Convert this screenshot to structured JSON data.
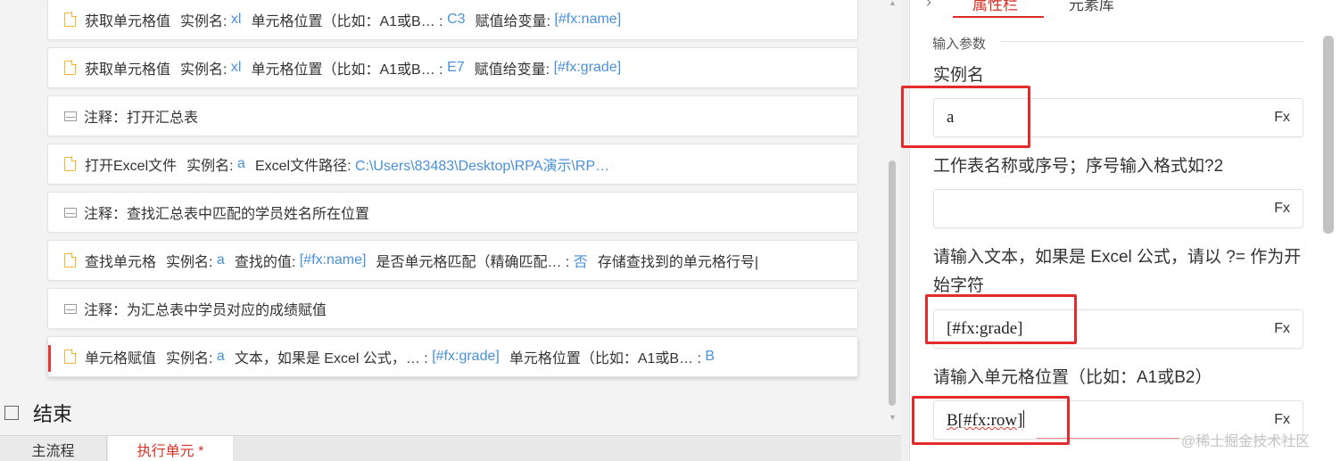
{
  "steps": [
    {
      "kind": "action",
      "title": "获取单元格值",
      "label1": "实例名:",
      "val1": "xl",
      "label2": "单元格位置（比如：A1或B… :",
      "val2": "C3",
      "label3": "赋值给变量:",
      "val3": "[#fx:name]"
    },
    {
      "kind": "action",
      "title": "获取单元格值",
      "label1": "实例名:",
      "val1": "xl",
      "label2": "单元格位置（比如：A1或B… :",
      "val2": "E7",
      "label3": "赋值给变量:",
      "val3": "[#fx:grade]"
    },
    {
      "kind": "comment",
      "title": "注释：打开汇总表"
    },
    {
      "kind": "action",
      "title": "打开Excel文件",
      "label1": "实例名:",
      "val1": "a",
      "label2": "Excel文件路径:",
      "val2": "C:\\Users\\83483\\Desktop\\RPA演示\\RP…"
    },
    {
      "kind": "comment",
      "title": "注释：查找汇总表中匹配的学员姓名所在位置"
    },
    {
      "kind": "action",
      "title": "查找单元格",
      "label1": "实例名:",
      "val1": "a",
      "label2": "查找的值:",
      "val2": "[#fx:name]",
      "label3": "是否单元格匹配（精确匹配… :",
      "val3": "否",
      "label4": "存储查找到的单元格行号|"
    },
    {
      "kind": "comment",
      "title": "注释：为汇总表中学员对应的成绩赋值"
    },
    {
      "kind": "action",
      "active": true,
      "title": "单元格赋值",
      "label1": "实例名:",
      "val1": "a",
      "label2": "文本，如果是 Excel 公式，… :",
      "val2": "[#fx:grade]",
      "label3": "单元格位置（比如：A1或B… :",
      "val3": "B"
    }
  ],
  "end_label": "结束",
  "bottom_tabs": {
    "main": "主流程",
    "exec": "执行单元 *"
  },
  "right_panel": {
    "tab_props": "属性栏",
    "tab_lib": "元素库",
    "section": "输入参数",
    "fields": [
      {
        "label": "实例名",
        "value": "a",
        "fx": "Fx"
      },
      {
        "label": "工作表名称或序号；序号输入格式如?2",
        "value": "",
        "fx": "Fx"
      },
      {
        "label": "请输入文本，如果是 Excel 公式，请以 ?= 作为开始字符",
        "value": "[#fx:grade]",
        "fx": "Fx"
      },
      {
        "label": "请输入单元格位置（比如：A1或B2）",
        "value": "B[#fx:row]",
        "fx": "Fx"
      }
    ]
  },
  "watermark": "@稀土掘金技术社区",
  "colors": {
    "accent": "#d93025",
    "value_blue": "#4a90d9",
    "highlight": "#e32b2b",
    "file_icon": "#f2b632"
  }
}
